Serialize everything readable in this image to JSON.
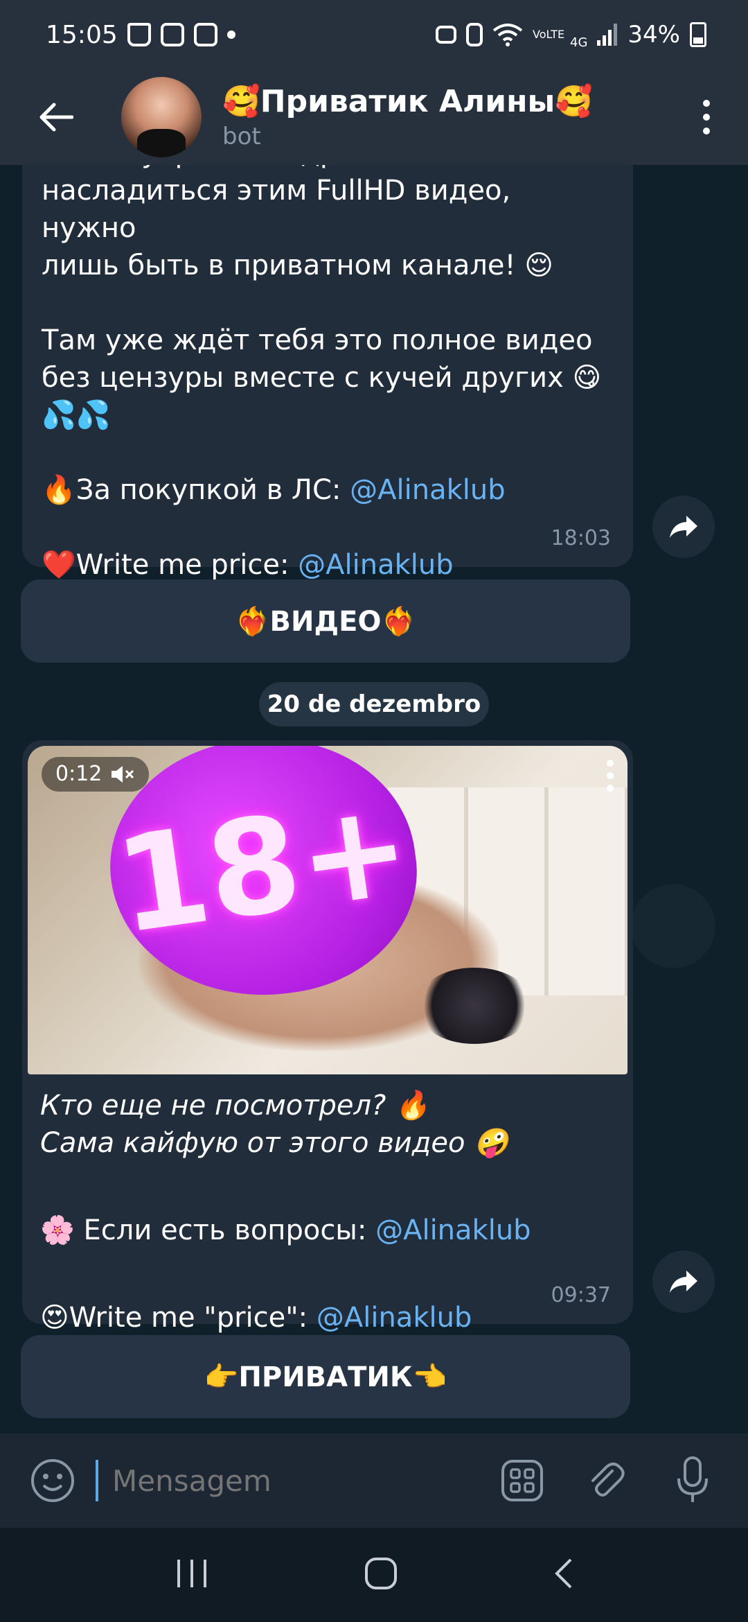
{
  "status_bar": {
    "time": "15:05",
    "network": "4G",
    "volte": "VoLTE",
    "battery": "34%"
  },
  "header": {
    "back_icon": "arrow-left-icon",
    "title": "🥰Приватик Алины🥰",
    "subtitle": "bot",
    "menu_icon": "more-vertical-icon"
  },
  "messages": [
    {
      "partial_line": "Чтобы убрать квадратики и",
      "lines": [
        "насладиться этим FullHD видео, нужно",
        "лишь быть в приватном канале! 😌"
      ],
      "para2": [
        "Там уже ждёт тебя это полное видео",
        "без цензуры вместе с кучей других 😋",
        "💦💦"
      ],
      "buy_prefix": "🔥За покупкой в ЛС: ",
      "buy_link": "@Alinaklub",
      "price_prefix": "❤️Write me price: ",
      "price_link": "@Alinaklub",
      "time": "18:03",
      "button": "❤️‍🔥ВИДЕО❤️‍🔥"
    },
    {
      "video_duration": "0:12",
      "badge": "18+",
      "line1": "Кто еще не посмотрел? 🔥",
      "line2": "Сама кайфую от этого видео 🤪",
      "questions_prefix": "🌸 Если есть вопросы: ",
      "questions_link": "@Alinaklub",
      "price_prefix": "😍Write me \"price\": ",
      "price_link": "@Alinaklub",
      "time": "09:37",
      "button": "👉ПРИВАТИК👈"
    }
  ],
  "date_separator": "20 de dezembro",
  "input": {
    "placeholder": "Mensagem"
  },
  "colors": {
    "header_bg": "#26313d",
    "bubble_bg": "#212d3b",
    "link": "#6ab3f3",
    "chat_bg": "#10202b"
  }
}
